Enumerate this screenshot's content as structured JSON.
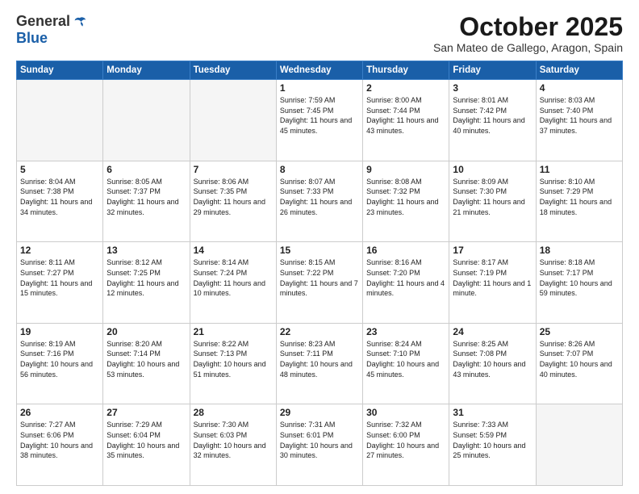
{
  "header": {
    "logo_general": "General",
    "logo_blue": "Blue",
    "title": "October 2025",
    "location": "San Mateo de Gallego, Aragon, Spain"
  },
  "days_of_week": [
    "Sunday",
    "Monday",
    "Tuesday",
    "Wednesday",
    "Thursday",
    "Friday",
    "Saturday"
  ],
  "weeks": [
    [
      {
        "day": "",
        "empty": true
      },
      {
        "day": "",
        "empty": true
      },
      {
        "day": "",
        "empty": true
      },
      {
        "day": "1",
        "sunrise": "7:59 AM",
        "sunset": "7:45 PM",
        "daylight": "11 hours and 45 minutes."
      },
      {
        "day": "2",
        "sunrise": "8:00 AM",
        "sunset": "7:44 PM",
        "daylight": "11 hours and 43 minutes."
      },
      {
        "day": "3",
        "sunrise": "8:01 AM",
        "sunset": "7:42 PM",
        "daylight": "11 hours and 40 minutes."
      },
      {
        "day": "4",
        "sunrise": "8:03 AM",
        "sunset": "7:40 PM",
        "daylight": "11 hours and 37 minutes."
      }
    ],
    [
      {
        "day": "5",
        "sunrise": "8:04 AM",
        "sunset": "7:38 PM",
        "daylight": "11 hours and 34 minutes."
      },
      {
        "day": "6",
        "sunrise": "8:05 AM",
        "sunset": "7:37 PM",
        "daylight": "11 hours and 32 minutes."
      },
      {
        "day": "7",
        "sunrise": "8:06 AM",
        "sunset": "7:35 PM",
        "daylight": "11 hours and 29 minutes."
      },
      {
        "day": "8",
        "sunrise": "8:07 AM",
        "sunset": "7:33 PM",
        "daylight": "11 hours and 26 minutes."
      },
      {
        "day": "9",
        "sunrise": "8:08 AM",
        "sunset": "7:32 PM",
        "daylight": "11 hours and 23 minutes."
      },
      {
        "day": "10",
        "sunrise": "8:09 AM",
        "sunset": "7:30 PM",
        "daylight": "11 hours and 21 minutes."
      },
      {
        "day": "11",
        "sunrise": "8:10 AM",
        "sunset": "7:29 PM",
        "daylight": "11 hours and 18 minutes."
      }
    ],
    [
      {
        "day": "12",
        "sunrise": "8:11 AM",
        "sunset": "7:27 PM",
        "daylight": "11 hours and 15 minutes."
      },
      {
        "day": "13",
        "sunrise": "8:12 AM",
        "sunset": "7:25 PM",
        "daylight": "11 hours and 12 minutes."
      },
      {
        "day": "14",
        "sunrise": "8:14 AM",
        "sunset": "7:24 PM",
        "daylight": "11 hours and 10 minutes."
      },
      {
        "day": "15",
        "sunrise": "8:15 AM",
        "sunset": "7:22 PM",
        "daylight": "11 hours and 7 minutes."
      },
      {
        "day": "16",
        "sunrise": "8:16 AM",
        "sunset": "7:20 PM",
        "daylight": "11 hours and 4 minutes."
      },
      {
        "day": "17",
        "sunrise": "8:17 AM",
        "sunset": "7:19 PM",
        "daylight": "11 hours and 1 minute."
      },
      {
        "day": "18",
        "sunrise": "8:18 AM",
        "sunset": "7:17 PM",
        "daylight": "10 hours and 59 minutes."
      }
    ],
    [
      {
        "day": "19",
        "sunrise": "8:19 AM",
        "sunset": "7:16 PM",
        "daylight": "10 hours and 56 minutes."
      },
      {
        "day": "20",
        "sunrise": "8:20 AM",
        "sunset": "7:14 PM",
        "daylight": "10 hours and 53 minutes."
      },
      {
        "day": "21",
        "sunrise": "8:22 AM",
        "sunset": "7:13 PM",
        "daylight": "10 hours and 51 minutes."
      },
      {
        "day": "22",
        "sunrise": "8:23 AM",
        "sunset": "7:11 PM",
        "daylight": "10 hours and 48 minutes."
      },
      {
        "day": "23",
        "sunrise": "8:24 AM",
        "sunset": "7:10 PM",
        "daylight": "10 hours and 45 minutes."
      },
      {
        "day": "24",
        "sunrise": "8:25 AM",
        "sunset": "7:08 PM",
        "daylight": "10 hours and 43 minutes."
      },
      {
        "day": "25",
        "sunrise": "8:26 AM",
        "sunset": "7:07 PM",
        "daylight": "10 hours and 40 minutes."
      }
    ],
    [
      {
        "day": "26",
        "sunrise": "7:27 AM",
        "sunset": "6:06 PM",
        "daylight": "10 hours and 38 minutes."
      },
      {
        "day": "27",
        "sunrise": "7:29 AM",
        "sunset": "6:04 PM",
        "daylight": "10 hours and 35 minutes."
      },
      {
        "day": "28",
        "sunrise": "7:30 AM",
        "sunset": "6:03 PM",
        "daylight": "10 hours and 32 minutes."
      },
      {
        "day": "29",
        "sunrise": "7:31 AM",
        "sunset": "6:01 PM",
        "daylight": "10 hours and 30 minutes."
      },
      {
        "day": "30",
        "sunrise": "7:32 AM",
        "sunset": "6:00 PM",
        "daylight": "10 hours and 27 minutes."
      },
      {
        "day": "31",
        "sunrise": "7:33 AM",
        "sunset": "5:59 PM",
        "daylight": "10 hours and 25 minutes."
      },
      {
        "day": "",
        "empty": true
      }
    ]
  ]
}
